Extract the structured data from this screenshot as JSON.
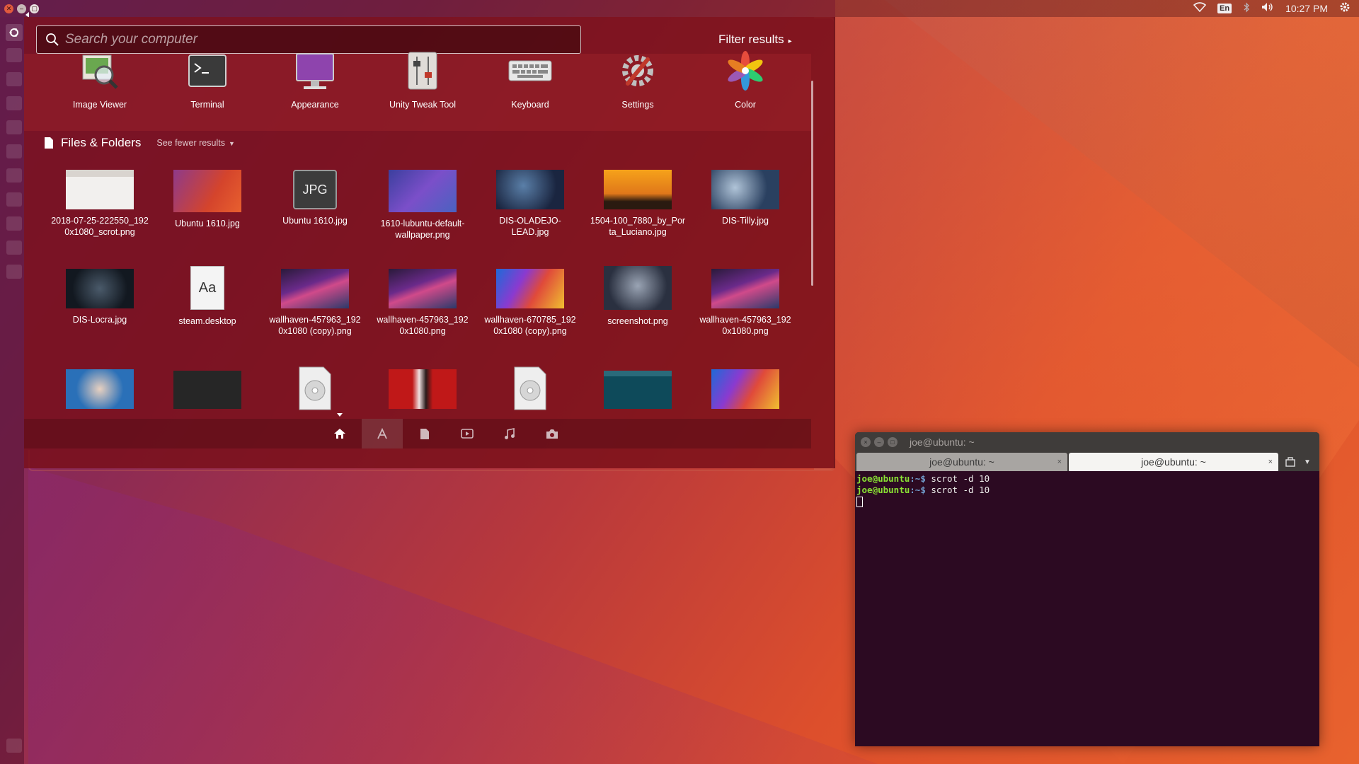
{
  "top_panel": {
    "language": "En",
    "clock": "10:27 PM"
  },
  "dash": {
    "search_placeholder": "Search your computer",
    "filter_results": "Filter results",
    "apps": [
      {
        "label": "Image Viewer",
        "icon": "image-viewer-icon"
      },
      {
        "label": "Terminal",
        "icon": "terminal-icon"
      },
      {
        "label": "Appearance",
        "icon": "appearance-icon"
      },
      {
        "label": "Unity Tweak Tool",
        "icon": "unity-tweak-tool-icon"
      },
      {
        "label": "Keyboard",
        "icon": "keyboard-icon"
      },
      {
        "label": "Settings",
        "icon": "settings-icon"
      },
      {
        "label": "Color",
        "icon": "color-icon"
      }
    ],
    "files_section": {
      "title": "Files & Folders",
      "see_fewer": "See fewer results"
    },
    "files_row1": [
      {
        "line1": "2018-07-25-222550_192",
        "line2": "0x1080_scrot.png"
      },
      {
        "line1": "Ubuntu 1610.jpg",
        "line2": ""
      },
      {
        "line1": "Ubuntu 1610.jpg",
        "line2": ""
      },
      {
        "line1": "1610-lubuntu-default-",
        "line2": "wallpaper.png"
      },
      {
        "line1": "DIS-OLADEJO-",
        "line2": "LEAD.jpg"
      },
      {
        "line1": "1504-100_7880_by_Por",
        "line2": "ta_Luciano.jpg"
      },
      {
        "line1": "DIS-Tilly.jpg",
        "line2": ""
      }
    ],
    "files_row2": [
      {
        "line1": "DIS-Locra.jpg",
        "line2": ""
      },
      {
        "line1": "steam.desktop",
        "line2": ""
      },
      {
        "line1": "wallhaven-457963_192",
        "line2": "0x1080 (copy).png"
      },
      {
        "line1": "wallhaven-457963_192",
        "line2": "0x1080.png"
      },
      {
        "line1": "wallhaven-670785_192",
        "line2": "0x1080 (copy).png"
      },
      {
        "line1": "screenshot.png",
        "line2": ""
      },
      {
        "line1": "wallhaven-457963_192",
        "line2": "0x1080.png"
      }
    ],
    "jpg_badge": "JPG",
    "desktop_badge": "Aa",
    "lenses": [
      "home-lens-icon",
      "applications-lens-icon",
      "files-lens-icon",
      "video-lens-icon",
      "music-lens-icon",
      "photos-lens-icon"
    ]
  },
  "terminal": {
    "title": "joe@ubuntu: ~",
    "tabs": [
      {
        "label": "joe@ubuntu: ~",
        "active": false
      },
      {
        "label": "joe@ubuntu: ~",
        "active": true
      }
    ],
    "tab_close": "×",
    "prompt_user": "joe@ubuntu",
    "prompt_path": ":~$",
    "lines": [
      "scrot -d 10",
      "scrot -d 10"
    ]
  },
  "colors": {
    "prompt_user": "#8ae234",
    "prompt_path": "#729fcf",
    "terminal_bg": "#2c0a22",
    "dash_bg": "#780f19"
  }
}
